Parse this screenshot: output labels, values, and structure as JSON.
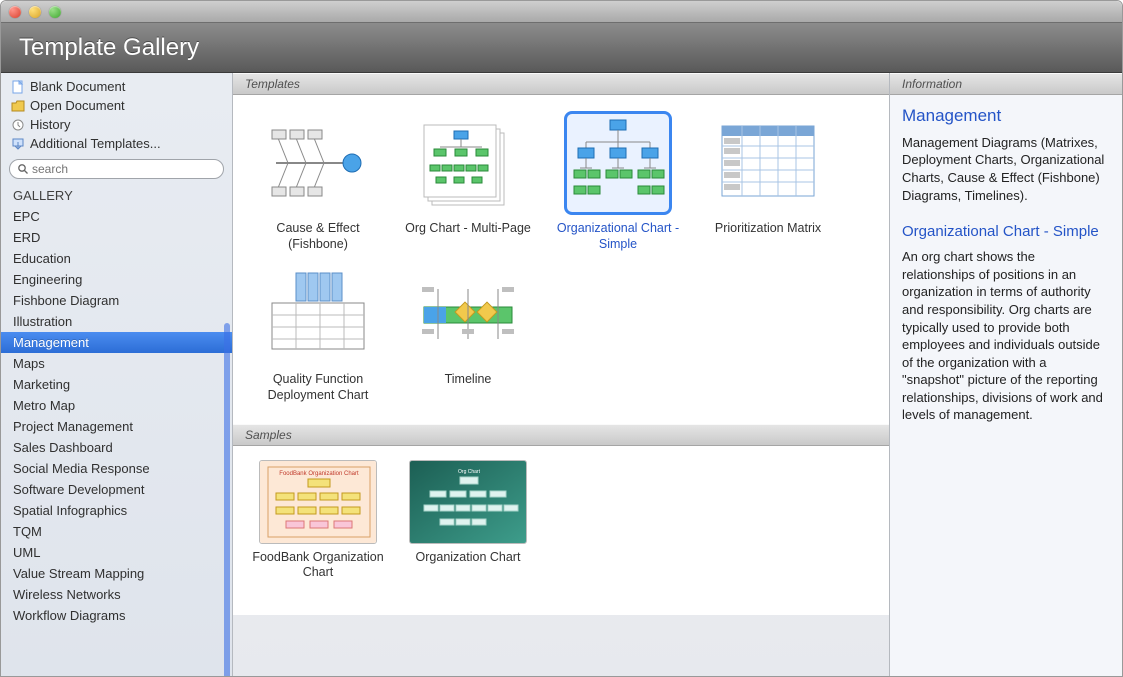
{
  "header": {
    "title": "Template Gallery"
  },
  "sidebar": {
    "top_links": [
      {
        "label": "Blank Document",
        "icon": "doc"
      },
      {
        "label": "Open Document",
        "icon": "folder"
      },
      {
        "label": "History",
        "icon": "history"
      },
      {
        "label": "Additional Templates...",
        "icon": "download"
      }
    ],
    "search_placeholder": "search",
    "gallery_header": "GALLERY",
    "categories": [
      "EPC",
      "ERD",
      "Education",
      "Engineering",
      "Fishbone Diagram",
      "Illustration",
      "Management",
      "Maps",
      "Marketing",
      "Metro Map",
      "Project Management",
      "Sales Dashboard",
      "Social Media Response",
      "Software Development",
      "Spatial Infographics",
      "TQM",
      "UML",
      "Value Stream Mapping",
      "Wireless Networks",
      "Workflow Diagrams"
    ],
    "selected_category": "Management"
  },
  "center": {
    "templates_label": "Templates",
    "samples_label": "Samples",
    "templates": [
      {
        "label": "Cause & Effect (Fishbone)"
      },
      {
        "label": "Org Chart - Multi-Page"
      },
      {
        "label": "Organizational Chart - Simple",
        "selected": true
      },
      {
        "label": "Prioritization Matrix"
      },
      {
        "label": "Quality Function Deployment Chart"
      },
      {
        "label": "Timeline"
      }
    ],
    "samples": [
      {
        "label": "FoodBank Organization Chart"
      },
      {
        "label": "Organization Chart"
      }
    ]
  },
  "info": {
    "section_label": "Information",
    "title": "Management",
    "summary": "Management Diagrams (Matrixes, Deployment Charts, Organizational Charts, Cause & Effect (Fishbone) Diagrams, Timelines).",
    "subtitle": "Organizational Chart - Simple",
    "detail": "An org chart shows the relationships of positions in an organization in terms of authority and responsibility. Org charts are typically used to provide both employees and individuals outside of the organization with a \"snapshot\" picture of the reporting relationships, divisions of work and levels of management."
  }
}
